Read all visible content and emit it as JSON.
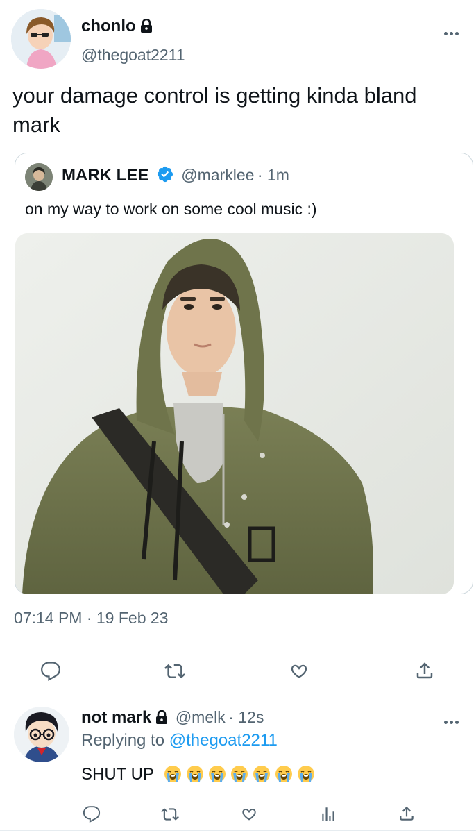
{
  "main_tweet": {
    "display_name": "chonlo",
    "handle": "@thegoat2211",
    "text": "your damage control is getting kinda bland mark",
    "timestamp": "07:14 PM · 19 Feb 23"
  },
  "quoted_tweet": {
    "display_name": "MARK LEE",
    "handle": "@marklee",
    "time": "· 1m",
    "text": "on my way to work on some cool music :)"
  },
  "reply_tweet": {
    "display_name": "not mark",
    "handle": "@melk",
    "time": "· 12s",
    "replying_prefix": "Replying to",
    "replying_to": "@thegoat2211",
    "text": "SHUT UP",
    "emoji_count": 7
  },
  "colors": {
    "accent": "#1d9bf0",
    "muted_text": "#536471",
    "verified": "#1d9bf0"
  },
  "icons": [
    "reply-icon",
    "retweet-icon",
    "like-icon",
    "share-icon",
    "analytics-icon",
    "lock-icon",
    "verified-badge-icon",
    "more-icon"
  ]
}
